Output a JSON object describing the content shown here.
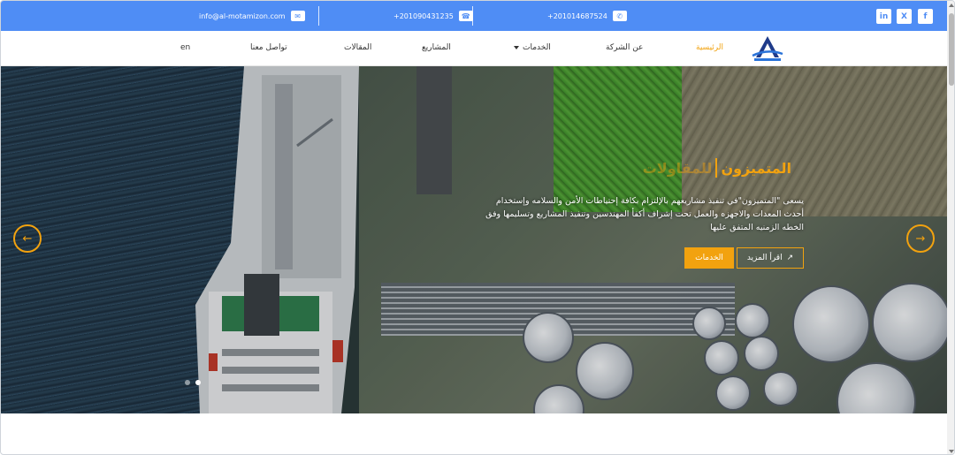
{
  "topbar": {
    "email": "info@al-motamizon.com",
    "phone_1": "+201090431235",
    "phone_2": "+201014687524",
    "social": [
      "in",
      "X",
      "f"
    ]
  },
  "nav": {
    "items": [
      {
        "label": "الرئيسية",
        "active": true
      },
      {
        "label": "عن الشركة"
      },
      {
        "label": "الخدمات",
        "dropdown": true
      },
      {
        "label": "المشاريع"
      },
      {
        "label": "المقالات"
      },
      {
        "label": "تواصل معنا"
      },
      {
        "label": "en"
      }
    ]
  },
  "hero": {
    "title": "المتميزون",
    "title_sub": "للمقاولات",
    "text": "يسعى \"المتميزون\"في تنفيذ مشاريعهم بالإلتزام بكافة إحتياطات الأمن والسلامه وإستخدام أحدث المعدات والاجهزه والعمل تحت إشراف أكفأ المهندسين وتنفيذ المشاريع وتسليمها وفق الخطه الزمنيه المتفق عليها",
    "btn_more": "اقرأ المزيد",
    "btn_services": "الخدمات",
    "slides": 2,
    "active_slide": 2
  },
  "colors": {
    "topbar": "#4f8df5",
    "accent": "#f2a20f"
  },
  "icons": {
    "email": "envelope-icon",
    "phone": "phone-icon",
    "whatsapp": "whatsapp-icon",
    "prev": "arrow-left-icon",
    "next": "arrow-right-icon",
    "more": "arrow-up-right-icon"
  }
}
